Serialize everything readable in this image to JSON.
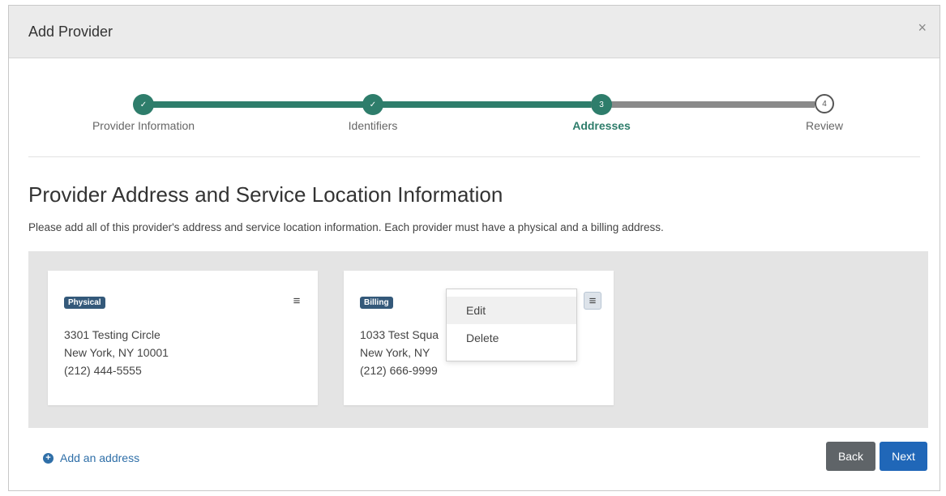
{
  "modal": {
    "title": "Add Provider",
    "close_glyph": "×"
  },
  "stepper": {
    "steps": [
      {
        "label": "Provider Information",
        "state": "complete",
        "marker": "✓"
      },
      {
        "label": "Identifiers",
        "state": "complete",
        "marker": "✓"
      },
      {
        "label": "Addresses",
        "state": "active",
        "marker": "3"
      },
      {
        "label": "Review",
        "state": "todo",
        "marker": "4"
      }
    ]
  },
  "section": {
    "title": "Provider Address and Service Location Information",
    "description": "Please add all of this provider's address and service location information. Each provider must have a physical and a billing address."
  },
  "cards": [
    {
      "badge": "Physical",
      "line1": "3301 Testing Circle",
      "line2": "New York, NY 10001",
      "phone": "(212) 444-5555",
      "menu_glyph": "≡"
    },
    {
      "badge": "Billing",
      "line1": "1033 Test Squa",
      "line2": "New York, NY",
      "phone": "(212) 666-9999",
      "menu_glyph": "≡"
    }
  ],
  "dropdown": {
    "items": [
      "Edit",
      "Delete"
    ]
  },
  "footer": {
    "add_address_label": "Add an address",
    "back_label": "Back",
    "next_label": "Next"
  },
  "colors": {
    "accent": "#2e7d6b",
    "inactive_track": "#8a8a8a",
    "badge": "#34597a",
    "link": "#2f6fa8",
    "back_button": "#5f6468",
    "next_button": "#2067b8"
  },
  "icons": [
    "close-icon",
    "checkmark-icon",
    "hamburger-menu-icon",
    "plus-circle-icon"
  ]
}
